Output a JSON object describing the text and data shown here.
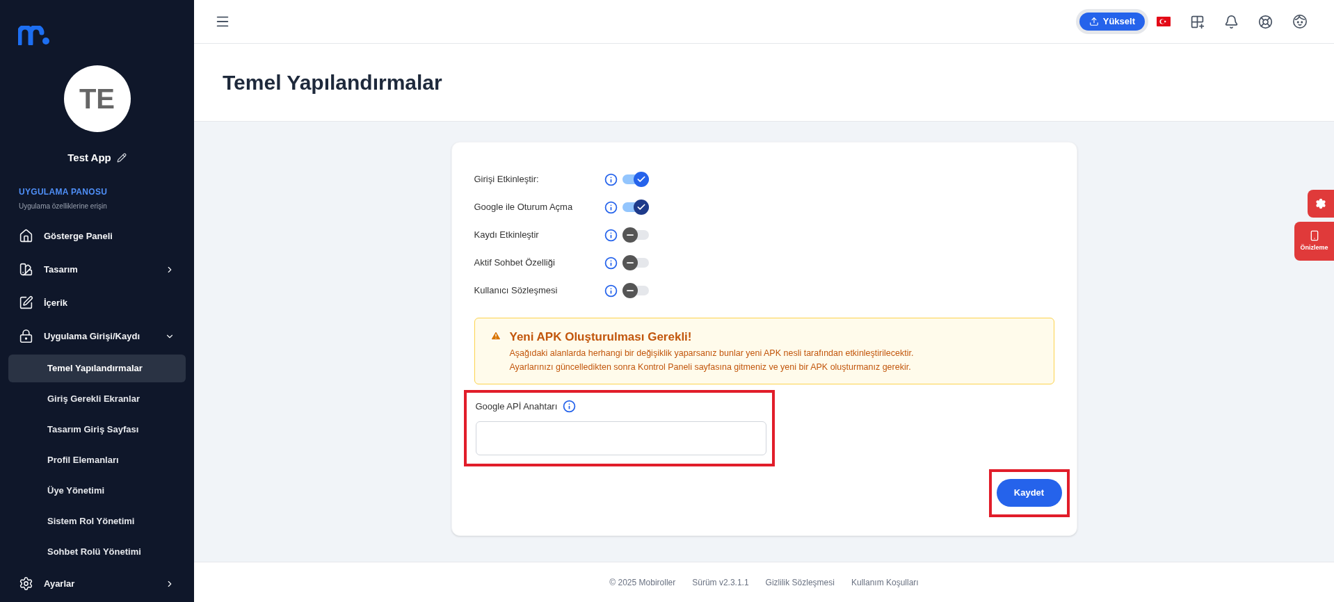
{
  "sidebar": {
    "app_name": "Test App",
    "avatar_initials": "TE",
    "section_title": "UYGULAMA PANOSU",
    "section_subtitle": "Uygulama özelliklerine erişin",
    "items": [
      {
        "label": "Gösterge Paneli",
        "kind": "link"
      },
      {
        "label": "Tasarım",
        "kind": "group",
        "expanded": false
      },
      {
        "label": "İçerik",
        "kind": "link"
      },
      {
        "label": "Uygulama Girişi/Kaydı",
        "kind": "group",
        "expanded": true,
        "children": [
          {
            "label": "Temel Yapılandırmalar",
            "selected": true
          },
          {
            "label": "Giriş Gerekli Ekranlar",
            "selected": false
          },
          {
            "label": "Tasarım Giriş Sayfası",
            "selected": false
          },
          {
            "label": "Profil Elemanları",
            "selected": false
          },
          {
            "label": "Üye Yönetimi",
            "selected": false
          },
          {
            "label": "Sistem Rol Yönetimi",
            "selected": false
          },
          {
            "label": "Sohbet Rolü Yönetimi",
            "selected": false
          }
        ]
      },
      {
        "label": "Ayarlar",
        "kind": "group",
        "expanded": false
      }
    ]
  },
  "topbar": {
    "upgrade_button": "Yükselt"
  },
  "page_title": "Temel Yapılandırmalar",
  "settings": [
    {
      "label": "Girişi Etkinleştir:",
      "on": true,
      "focused": false
    },
    {
      "label": "Google ile Oturum Açma",
      "on": true,
      "focused": true
    },
    {
      "label": "Kaydı Etkinleştir",
      "on": false,
      "focused": false
    },
    {
      "label": "Aktif Sohbet Özelliği",
      "on": false,
      "focused": false
    },
    {
      "label": "Kullanıcı Sözleşmesi",
      "on": false,
      "focused": false
    }
  ],
  "warning": {
    "title": "Yeni APK Oluşturulması Gerekli!",
    "lines": [
      "Aşağıdaki alanlarda herhangi bir değişiklik yaparsanız bunlar yeni APK nesli tarafından etkinleştirilecektir.",
      "Ayarlarınızı güncelledikten sonra Kontrol Paneli sayfasına gitmeniz ve yeni bir APK oluşturmanız gerekir."
    ]
  },
  "api_key": {
    "label": "Google APİ Anahtarı",
    "highlighted": true
  },
  "save_button": {
    "label": "Kaydet",
    "highlighted": true
  },
  "floating": {
    "preview_label": "Önizleme"
  },
  "footer": [
    "© 2025 Mobiroller",
    "Sürüm v2.3.1.1",
    "Gizlilik Sözleşmesi",
    "Kullanım Koşulları"
  ]
}
